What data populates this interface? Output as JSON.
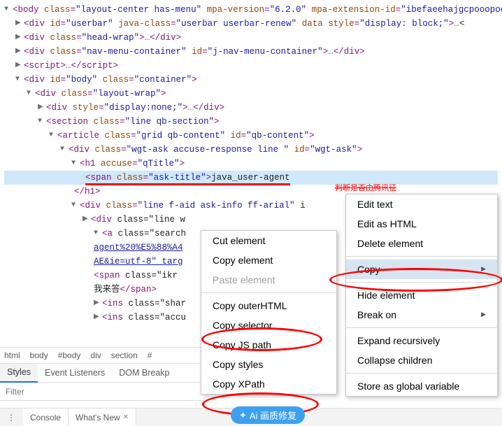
{
  "dom": {
    "body_open": "<body class=\"layout-center has-menu\" mpa-version=\"6.2.0\" mpa-extension-id=\"ibefaeehajgcpooopoegkifhgecigeeg\" style>",
    "userbar": "<div id=\"userbar\" java-class=\"userbar userbar-renew\" data style=\"display: block;\">…<",
    "headwrap": "<div class=\"head-wrap\">…</div>",
    "navmenu": "<div class=\"nav-menu-container\" id=\"j-nav-menu-container\">…</div>",
    "script": "<script>…</script>",
    "body2": "<div id=\"body\" class=\"container\">",
    "layoutwrap": "<div class=\"layout-wrap\">",
    "disnone": "<div style=\"display:none;\">…</div>",
    "section": "<section class=\"line qb-section\">",
    "article": "<article class=\"grid qb-content\" id=\"qb-content\">",
    "wgtask": "<div class=\"wgt-ask accuse-response line \" id=\"wgt-ask\">",
    "h1": "<h1 accuse=\"qTitle\">",
    "span_raw_a": "<span class=\"ask-title\">",
    "span_raw_b": "java_user-agent ",
    "span_side": "判断是否由腾讯征",
    "h1close": "</h1>",
    "faid": "<div class=\"line f-aid ask-info ff-arial\" i",
    "linew": "<div class=\"line w",
    "a_search": "<a class=\"search",
    "linktext": "agent%20%E5%88%A4",
    "linktail": "AE&ie=utf-8\" targ",
    "ikr": "<span class=\"ikr",
    "ikr_text": "我来答</span>",
    "ins1": "<ins class=\"shar",
    "ins2": "<ins class=\"accu"
  },
  "crumbs": [
    "html",
    "body",
    "#body",
    "div",
    "section",
    "#"
  ],
  "tabs2": [
    "Styles",
    "Event Listeners",
    "DOM Breakp"
  ],
  "filter_placeholder": "Filter",
  "console_tabs": [
    "Console",
    "What's New"
  ],
  "menu1": {
    "cut": "Cut element",
    "copy": "Copy element",
    "paste": "Paste element",
    "outer": "Copy outerHTML",
    "selector": "Copy selector",
    "jspath": "Copy JS path",
    "styles": "Copy styles",
    "xpath": "Copy XPath"
  },
  "menu2": {
    "edit_text": "Edit text",
    "edit_html": "Edit as HTML",
    "delete": "Delete element",
    "copy": "Copy",
    "hide": "Hide element",
    "break": "Break on",
    "expand": "Expand recursively",
    "collapse": "Collapse children",
    "store": "Store as global variable"
  },
  "ai_badge": "Ai 画质修复"
}
